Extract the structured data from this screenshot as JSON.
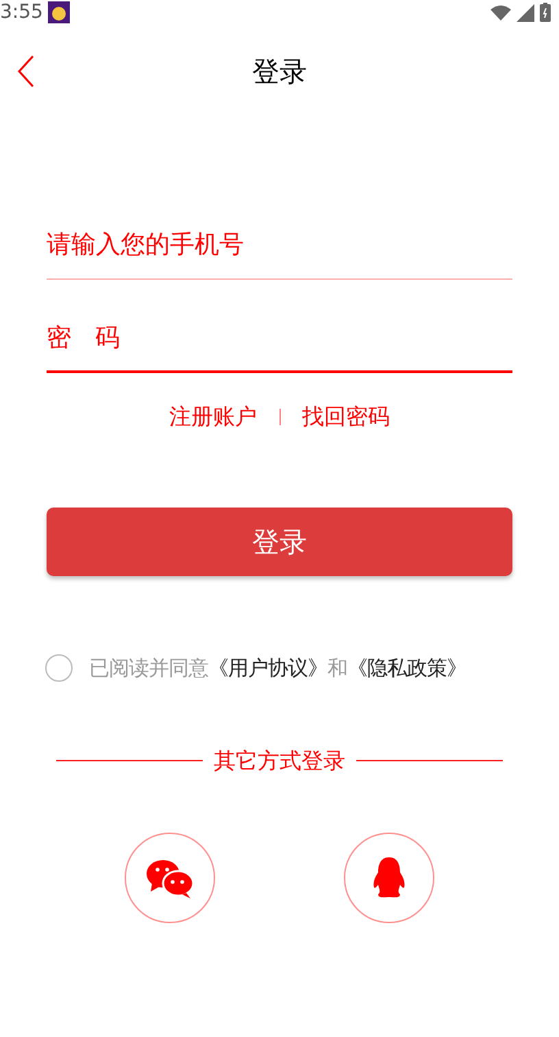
{
  "status_bar": {
    "time": "3:55"
  },
  "nav": {
    "title": "登录"
  },
  "fields": [
    {
      "kind": "phone",
      "placeholder": "请输入您的手机号",
      "focused": false
    },
    {
      "kind": "password",
      "placeholder": "密 码",
      "focused": true
    }
  ],
  "links": [
    "注册账户",
    "找回密码"
  ],
  "login_button": "登录",
  "agreement": {
    "checked": false,
    "parts": [
      {
        "kind": "plain",
        "text": "已阅读并同意"
      },
      {
        "kind": "link",
        "text": "《用户协议》"
      },
      {
        "kind": "plain",
        "text": "和"
      },
      {
        "kind": "link",
        "text": "《隐私政策》"
      }
    ]
  },
  "other_login": {
    "title": "其它方式登录",
    "options": [
      {
        "kind": "wechat"
      },
      {
        "kind": "qq"
      }
    ]
  }
}
